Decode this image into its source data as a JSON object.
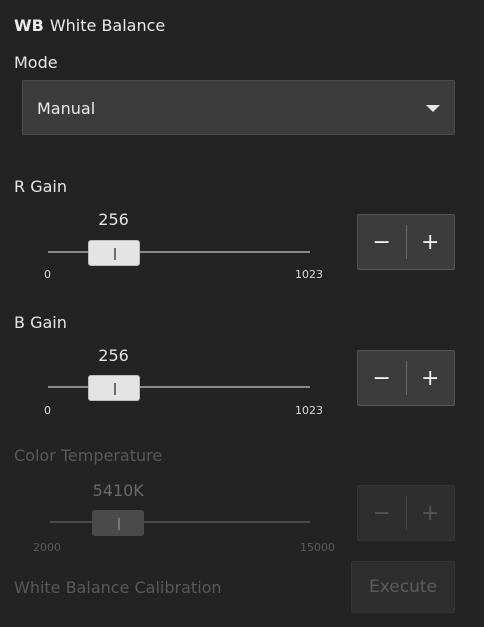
{
  "header": {
    "short": "WB",
    "title": "White Balance"
  },
  "mode": {
    "label": "Mode",
    "selected": "Manual"
  },
  "r_gain": {
    "label": "R Gain",
    "value": "256",
    "min": "0",
    "max": "1023",
    "position": 256,
    "range": [
      0,
      1023
    ],
    "minus": "−",
    "plus": "+"
  },
  "b_gain": {
    "label": "B Gain",
    "value": "256",
    "min": "0",
    "max": "1023",
    "position": 256,
    "range": [
      0,
      1023
    ],
    "minus": "−",
    "plus": "+"
  },
  "color_temp": {
    "label": "Color Temperature",
    "value": "5410K",
    "min": "2000",
    "max": "15000",
    "position": 5410,
    "range": [
      2000,
      15000
    ],
    "minus": "−",
    "plus": "+",
    "disabled": true
  },
  "calibration": {
    "label": "White Balance Calibration",
    "button": "Execute",
    "disabled": true
  },
  "icons": {
    "dropdown": "caret-down-icon"
  },
  "colors": {
    "background": "#232323",
    "control": "#3c3c3c",
    "text": "#e6e6e6",
    "disabled_text": "#595959"
  }
}
